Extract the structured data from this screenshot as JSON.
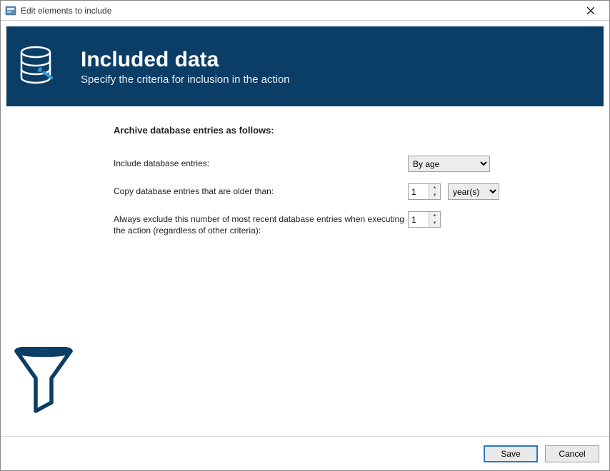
{
  "window": {
    "title": "Edit elements to include"
  },
  "header": {
    "title": "Included data",
    "subtitle": "Specify the criteria for inclusion in the action"
  },
  "section": {
    "heading": "Archive database entries as follows:"
  },
  "form": {
    "include_label": "Include database entries:",
    "include_value": "By age",
    "older_than_label": "Copy database entries that are older than:",
    "older_than_value": "1",
    "older_than_unit": "year(s)",
    "exclude_label": "Always exclude this number of most recent database entries when executing the action (regardless of other criteria):",
    "exclude_value": "1"
  },
  "footer": {
    "save": "Save",
    "cancel": "Cancel"
  }
}
